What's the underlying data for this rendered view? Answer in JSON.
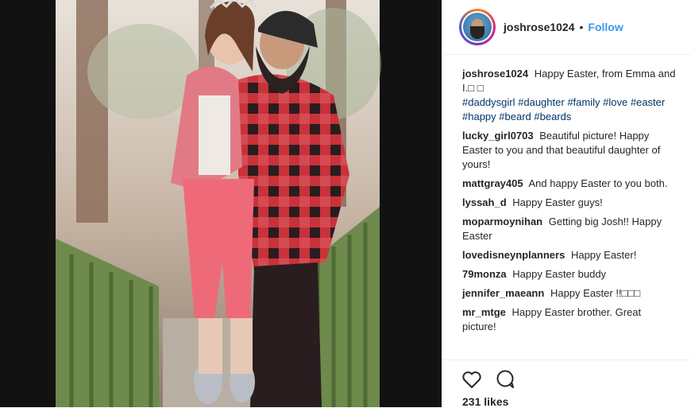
{
  "post": {
    "username": "joshrose1024",
    "separator": "•",
    "follow_label": "Follow"
  },
  "caption": {
    "username": "joshrose1024",
    "text": "Happy Easter, from Emma and I.□ □",
    "hashtags": [
      "#daddysgirl",
      "#daughter",
      "#family",
      "#love",
      "#easter",
      "#happy",
      "#beard",
      "#beards"
    ]
  },
  "comments": [
    {
      "user": "lucky_girl0703",
      "text": "Beautiful picture! Happy Easter to you and that beautiful daughter of yours!"
    },
    {
      "user": "mattgray405",
      "text": "And happy Easter to you both."
    },
    {
      "user": "lyssah_d",
      "text": "Happy Easter guys!"
    },
    {
      "user": "moparmoynihan",
      "text": "Getting big Josh!! Happy Easter"
    },
    {
      "user": "lovedisneynplanners",
      "text": "Happy Easter!"
    },
    {
      "user": "79monza",
      "text": "Happy Easter buddy"
    },
    {
      "user": "jennifer_maeann",
      "text": "Happy Easter !!□□□"
    },
    {
      "user": "mr_mtge",
      "text": "Happy Easter brother. Great picture!"
    }
  ],
  "actions": {
    "like_icon": "heart-icon",
    "comment_icon": "comment-bubble-icon"
  },
  "likes_label": "231 likes",
  "colors": {
    "follow": "#3897f0",
    "hashtag": "#003569",
    "text": "#262626",
    "divider": "#efefef"
  }
}
